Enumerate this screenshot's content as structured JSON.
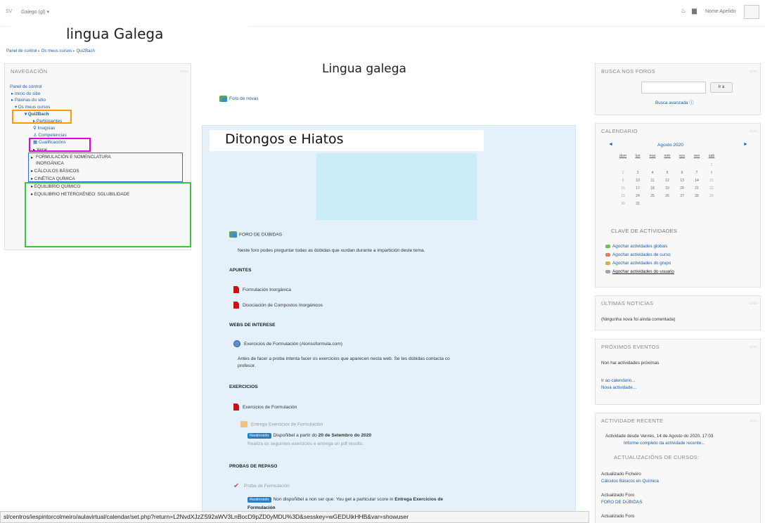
{
  "topbar": {
    "brand": "SV",
    "language": "Galego (gl) ▾",
    "user_name": "Nome Apelido"
  },
  "overlay_title": "lingua Galega",
  "breadcrumb": [
    "Panel de control",
    "Os meus cursos",
    "Qui2Bach"
  ],
  "breadcrumb_sep": "▸",
  "nav": {
    "header": "NAVEGACIÓN",
    "items": [
      "Panel de control",
      "▸ Inicio do sitio",
      "▸ Páxinas do sitio",
      "▾ Os meus cursos",
      "▾ Qui2Bach",
      "▸ Participantes",
      "Insignias",
      "Competencias",
      "Cualificacións",
      "▸ Xeral",
      "FORMULACIÓN E NOMENCLATURA",
      "INORGÁNICA",
      "▸ CÁLCULOS BÁSICOS",
      "▸ CINÉTICA QUÍMICA",
      "▸ EQUILIBRIO QUÍMICO",
      "▸ EQUILIBRIO HETEROXÉNEO: SOLUBILIDADE"
    ],
    "item0_caret": "▸",
    "highlight_colors": [
      "#ff9a00",
      "#e000e0",
      "#2a6cd8",
      "#3ec43e"
    ]
  },
  "center_title": "Lingua galega",
  "foro_novas": "Foro de novas",
  "topic": {
    "title": "Ditongos e Hiatos",
    "foro_dubidas": "FORO DE DÚBIDAS",
    "foro_desc": "Neste foro podes preguntar todas as dúbidas que xurdan durante a impartición deste tema.",
    "apuntes": "APUNTES",
    "apuntes_items": [
      "Formulación Inorgánica",
      "Disociación de Compostos Inorgánicos"
    ],
    "webs": "WEBS DE INTERESE",
    "web_item": "Exercicios de Formulación (Alonsoformula.com)",
    "web_desc1": "Antes de facer a proba intenta facer os exercicios que aparecen nesta web. Se tes dúbidas contacta co",
    "web_desc2": "profesor.",
    "exercicios": "EXERCICIOS",
    "ex_item": "Exercicios de Formulación",
    "entrega": "Entrega Exercicios de Formulación",
    "restrinxido": "Restrinxido",
    "disp": "Dispoñibel a partir do",
    "disp_date": "20 de Setembro do 2020",
    "realiza": "Realiza os seguintes exercicios e entrega un pdf resolto.",
    "probas": "PROBAS DE REPASO",
    "proba_item": "Proba de Formulación",
    "non_disp": "Non dispoñibel a non ser que: You get a particular score in",
    "non_disp_bold": "Entrega Exercicios de",
    "formulacion": "Formulación"
  },
  "statusbar": "sl/centros/iespintorcolmeiro/aulavirtual/calendar/set.php?return=L2NvdXJzZS92aWV3LnBocD9pZD0yMDU%3D&sesskey=wGEDUikHHB&var=showuser",
  "busca": {
    "header": "BUSCA NOS FOROS",
    "button": "Ir a",
    "advanced": "Busca avanzada ⓘ"
  },
  "calendar": {
    "header": "CALENDARIO",
    "month": "Agosto 2020",
    "prev": "◄",
    "next": "►",
    "days": [
      "dom",
      "lun",
      "mar",
      "mér",
      "xov",
      "ven",
      "sáb"
    ],
    "weeks": [
      [
        "",
        "",
        "",
        "",
        "",
        "",
        "1"
      ],
      [
        "2",
        "3",
        "4",
        "5",
        "6",
        "7",
        "8"
      ],
      [
        "9",
        "10",
        "11",
        "12",
        "13",
        "14",
        "15"
      ],
      [
        "16",
        "17",
        "18",
        "19",
        "20",
        "21",
        "22"
      ],
      [
        "23",
        "24",
        "25",
        "26",
        "27",
        "28",
        "29"
      ],
      [
        "30",
        "31",
        "",
        "",
        "",
        "",
        ""
      ]
    ],
    "clave": "CLAVE DE ACTIVIDADES",
    "events": [
      "Agochar actividades globais",
      "Agochar actividades de curso",
      "Agochar actividades do grupo",
      "Agochar actividades do usuario"
    ],
    "event_colors": [
      "#6cbf59",
      "#e07a6a",
      "#e0a84a",
      "#9aa3b5"
    ]
  },
  "news": {
    "header": "ÚLTIMAS NOTICIAS",
    "text": "(Ningunha nova foi aínda comentada)"
  },
  "eventos": {
    "header": "PRÓXIMOS EVENTOS",
    "text": "Non hai actividades próximas",
    "link1": "Ir ao calendario...",
    "link2": "Nova actividade..."
  },
  "actividade": {
    "header": "ACTIVIDADE RECENTE",
    "since": "Actividade desde Venres, 14 de Agosto do 2020, 17:03",
    "report": "Informe completo da actividade recente...",
    "updates": "ACTUALIZACIÓNS DE CURSOS:",
    "u1": "Actualizado Ficheiro",
    "u1link": "Cálculos Básicos en Química",
    "u2": "Actualizado Foro",
    "u2link": "FORO DE DÚBIDAS",
    "u3": "Actualizado Foro"
  }
}
